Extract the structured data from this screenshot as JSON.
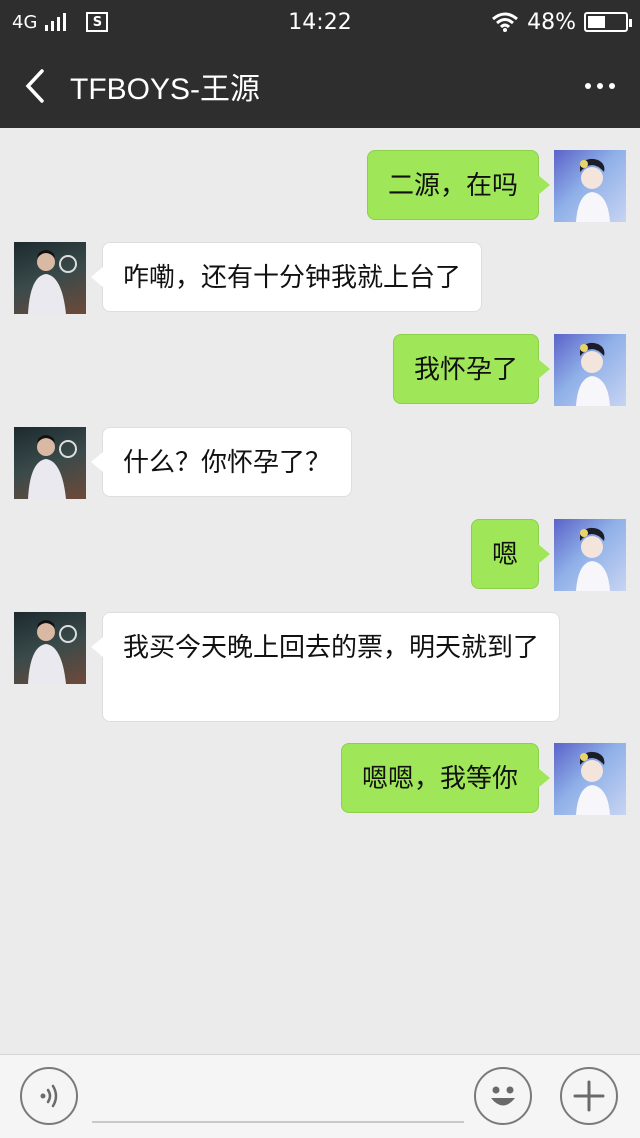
{
  "status_bar": {
    "network": "4G",
    "time": "14:22",
    "battery": "48%",
    "battery_level": 0.48
  },
  "header": {
    "title": "TFBOYS-王源"
  },
  "messages": [
    {
      "sender": "me",
      "text": "二源，在吗"
    },
    {
      "sender": "friend",
      "text": "咋嘞，还有十分钟我就上台了"
    },
    {
      "sender": "me",
      "text": "我怀孕了"
    },
    {
      "sender": "friend",
      "text": "什么？你怀孕了？"
    },
    {
      "sender": "me",
      "text": "嗯"
    },
    {
      "sender": "friend",
      "text": "我买今天晚上回去的票，明天就到了"
    },
    {
      "sender": "me",
      "text": "嗯嗯，我等你"
    }
  ],
  "input_bar": {
    "placeholder": "",
    "icons": [
      "voice-icon",
      "emoji-icon",
      "plus-icon"
    ]
  },
  "colors": {
    "bar": "#2e2e2e",
    "my_bubble": "#9fe658",
    "friend_bubble": "#ffffff",
    "background": "#ebebeb"
  }
}
